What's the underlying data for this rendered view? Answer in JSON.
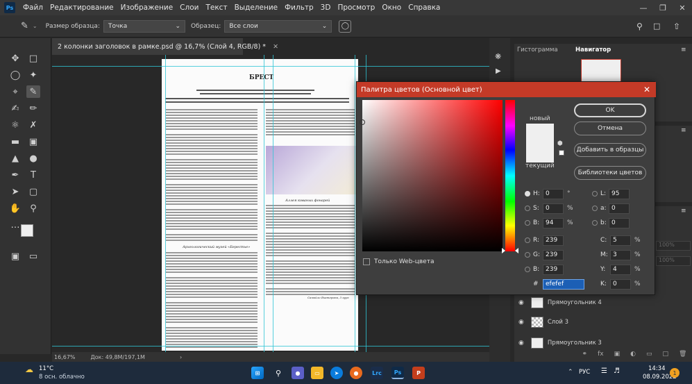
{
  "menu": {
    "items": [
      "Файл",
      "Редактирование",
      "Изображение",
      "Слои",
      "Текст",
      "Выделение",
      "Фильтр",
      "3D",
      "Просмотр",
      "Окно",
      "Справка"
    ],
    "logo": "Ps"
  },
  "options": {
    "sample_size_label": "Размер образца:",
    "sample_size_value": "Точка",
    "sample_label": "Образец:",
    "sample_value": "Все слои"
  },
  "document": {
    "tab_title": "2 колонки заголовок в рамке.psd @ 16,7% (Слой 4, RGB/8) *",
    "page_heading": "БРЕСТ",
    "caption1": "Аллея кованых фонарей",
    "caption2": "Археологический музей «Берестье»",
    "signature": "Самойло Екатерина, 3 курс"
  },
  "status": {
    "zoom": "16,67%",
    "doc_size": "Док: 49,8M/197,1M"
  },
  "right_panel": {
    "tab_histogram": "Гистограмма",
    "tab_navigator": "Навигатор",
    "opacity_1": "100%",
    "opacity_2": "100%",
    "layers": [
      "Прямоугольник 4",
      "Слой 3",
      "Прямоугольник 3"
    ]
  },
  "picker": {
    "title": "Палитра цветов (Основной цвет)",
    "ok": "OK",
    "cancel": "Отмена",
    "add_swatch": "Добавить в образцы",
    "libraries": "Библиотеки цветов",
    "new_label": "новый",
    "current_label": "текущий",
    "web_only": "Только Web-цвета",
    "H": "0",
    "S": "0",
    "B": "94",
    "R": "239",
    "G": "239",
    "Bv": "239",
    "L": "95",
    "a": "0",
    "b": "0",
    "C": "5",
    "M": "3",
    "Y": "4",
    "K": "0",
    "hex": "efefef",
    "labels": {
      "H": "H:",
      "S": "S:",
      "B": "B:",
      "R": "R:",
      "G": "G:",
      "Bv": "B:",
      "L": "L:",
      "a": "a:",
      "b": "b:",
      "C": "C:",
      "M": "M:",
      "Y": "Y:",
      "K": "K:",
      "hash": "#"
    },
    "units": {
      "deg": "°",
      "pct": "%"
    },
    "new_color": "#efefef",
    "current_color": "#efefef"
  },
  "taskbar": {
    "temp": "11°C",
    "weather": "8 осн. облачно",
    "lang": "РУС",
    "time": "14:34",
    "date": "08.09.2022",
    "notif_count": "1"
  },
  "colors": {
    "accent_red": "#c43a27",
    "guide": "#2ec5d6",
    "photoshop_blue": "#31a8ff"
  }
}
